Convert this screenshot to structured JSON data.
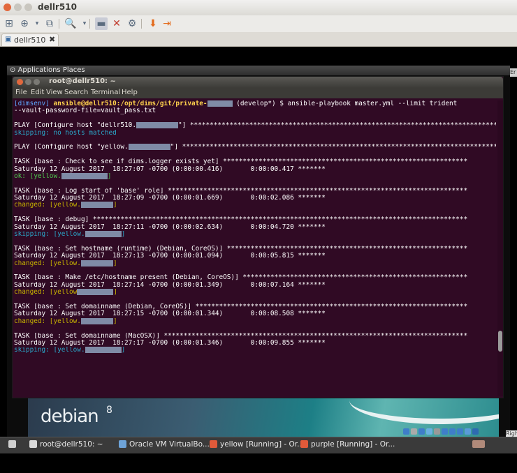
{
  "host": {
    "title": "dellr510",
    "tab_label": "dellr510",
    "right_edge_label": "Er",
    "right_ctrl_label": "Right C"
  },
  "guest": {
    "panel_apps": "⊙ Applications  Places",
    "terminal_title": "root@dellr510: ~",
    "menu": [
      "File",
      "Edit",
      "View",
      "Search",
      "Terminal",
      "Help"
    ],
    "debian_logo": "debian",
    "debian_version": "8"
  },
  "terminal": {
    "lines": [
      {
        "segments": [
          {
            "t": "[dimsenv] ",
            "c": "c-prompt-env"
          },
          {
            "t": "ansible@dellr510:/opt/dims/git/private-",
            "c": "c-prompt-user"
          },
          {
            "r": 36
          },
          {
            "t": " (develop*) $ ansible-playbook master.yml --limit trident",
            "c": ""
          }
        ]
      },
      {
        "segments": [
          {
            "t": "--vault-password-file=vault_pass.txt",
            "c": ""
          }
        ]
      },
      {
        "segments": []
      },
      {
        "segments": [
          {
            "t": "PLAY [Configure host \"dellr510.",
            "c": ""
          },
          {
            "r": 60
          },
          {
            "t": "\"] ************************************************************************************************",
            "c": ""
          }
        ]
      },
      {
        "segments": [
          {
            "t": "skipping: no hosts matched",
            "c": "c-skip"
          }
        ]
      },
      {
        "segments": []
      },
      {
        "segments": [
          {
            "t": "PLAY [Configure host \"yellow.",
            "c": ""
          },
          {
            "r": 60
          },
          {
            "t": "\"] ************************************************************************************************",
            "c": ""
          }
        ]
      },
      {
        "segments": []
      },
      {
        "segments": [
          {
            "t": "TASK [base : Check to see if dims.logger exists yet] **************************************************************",
            "c": ""
          }
        ]
      },
      {
        "segments": [
          {
            "t": "Saturday 12 August 2017  18:27:07 -0700 (0:00:00.416)       0:00:00.417 *******",
            "c": ""
          }
        ]
      },
      {
        "segments": [
          {
            "t": "ok: [yellow.",
            "c": "c-ok"
          },
          {
            "r": 66
          },
          {
            "t": "]",
            "c": "c-ok"
          }
        ]
      },
      {
        "segments": []
      },
      {
        "segments": [
          {
            "t": "TASK [base : Log start of 'base' role] ****************************************************************************",
            "c": ""
          }
        ]
      },
      {
        "segments": [
          {
            "t": "Saturday 12 August 2017  18:27:09 -0700 (0:00:01.669)       0:00:02.086 *******",
            "c": ""
          }
        ]
      },
      {
        "segments": [
          {
            "t": "changed: [yellow.",
            "c": "c-changed"
          },
          {
            "r": 46
          },
          {
            "t": "]",
            "c": "c-changed"
          }
        ]
      },
      {
        "segments": []
      },
      {
        "segments": [
          {
            "t": "TASK [base : debug] ***********************************************************************************************",
            "c": ""
          }
        ]
      },
      {
        "segments": [
          {
            "t": "Saturday 12 August 2017  18:27:11 -0700 (0:00:02.634)       0:00:04.720 *******",
            "c": ""
          }
        ]
      },
      {
        "segments": [
          {
            "t": "skipping: [yellow.",
            "c": "c-skip"
          },
          {
            "r": 52
          },
          {
            "t": "]",
            "c": "c-skip"
          }
        ]
      },
      {
        "segments": []
      },
      {
        "segments": [
          {
            "t": "TASK [base : Set hostname (runtime) (Debian, CoreOS)] *************************************************************",
            "c": ""
          }
        ]
      },
      {
        "segments": [
          {
            "t": "Saturday 12 August 2017  18:27:13 -0700 (0:00:01.094)       0:00:05.815 *******",
            "c": ""
          }
        ]
      },
      {
        "segments": [
          {
            "t": "changed: [yellow.",
            "c": "c-changed"
          },
          {
            "r": 46
          },
          {
            "t": "]",
            "c": "c-changed"
          }
        ]
      },
      {
        "segments": []
      },
      {
        "segments": [
          {
            "t": "TASK [base : Make /etc/hostname present (Debian, CoreOS)] *********************************************************",
            "c": ""
          }
        ]
      },
      {
        "segments": [
          {
            "t": "Saturday 12 August 2017  18:27:14 -0700 (0:00:01.349)       0:00:07.164 *******",
            "c": ""
          }
        ]
      },
      {
        "segments": [
          {
            "t": "changed: [yellow",
            "c": "c-changed"
          },
          {
            "r": 52
          },
          {
            "t": "]",
            "c": "c-changed"
          }
        ]
      },
      {
        "segments": []
      },
      {
        "segments": [
          {
            "t": "TASK [base : Set domainname (Debian, CoreOS)] *********************************************************************",
            "c": ""
          }
        ]
      },
      {
        "segments": [
          {
            "t": "Saturday 12 August 2017  18:27:15 -0700 (0:00:01.344)       0:00:08.508 *******",
            "c": ""
          }
        ]
      },
      {
        "segments": [
          {
            "t": "changed: [yellow.",
            "c": "c-changed"
          },
          {
            "r": 46
          },
          {
            "t": "]",
            "c": "c-changed"
          }
        ]
      },
      {
        "segments": []
      },
      {
        "segments": [
          {
            "t": "TASK [base : Set domainname (MacOSX)] *****************************************************************************",
            "c": ""
          }
        ]
      },
      {
        "segments": [
          {
            "t": "Saturday 12 August 2017  18:27:17 -0700 (0:00:01.346)       0:00:09.855 *******",
            "c": ""
          }
        ]
      },
      {
        "segments": [
          {
            "t": "skipping: [yellow.",
            "c": "c-skip"
          },
          {
            "r": 52
          },
          {
            "t": "]",
            "c": "c-skip"
          }
        ]
      }
    ]
  },
  "taskbar": {
    "items": [
      {
        "label": "root@dellr510: ~",
        "icon_color": "#d9d9d9"
      },
      {
        "label": "Oracle VM VirtualBo...",
        "icon_color": "#6ea3d8"
      },
      {
        "label": "yellow [Running] - Or...",
        "icon_color": "#e05a3a"
      },
      {
        "label": "purple [Running] - Or...",
        "icon_color": "#e05a3a"
      }
    ]
  },
  "colors": {
    "terminal_bg": "#300a24",
    "prompt_user": "#ffd24d",
    "skip": "#2aa7c9",
    "ok": "#4ec94e",
    "changed": "#c8b400"
  }
}
